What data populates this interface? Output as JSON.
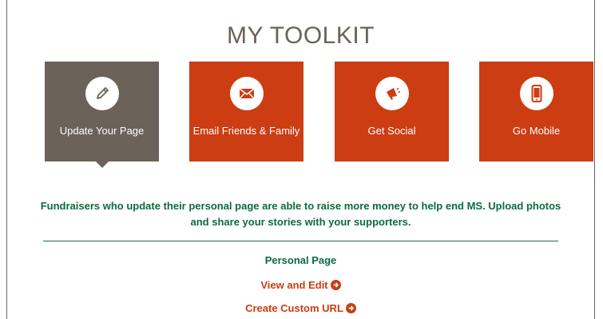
{
  "title": "MY TOOLKIT",
  "tiles": [
    {
      "label": "Update Your Page",
      "icon": "pencil-icon",
      "active": true
    },
    {
      "label": "Email Friends & Family",
      "icon": "envelope-icon",
      "active": false
    },
    {
      "label": "Get Social",
      "icon": "megaphone-icon",
      "active": false
    },
    {
      "label": "Go Mobile",
      "icon": "mobile-phone-icon",
      "active": false
    }
  ],
  "description": "Fundraisers who update their personal page are able to raise more money to help end MS. Upload photos and share your stories with your supporters.",
  "section": {
    "title": "Personal Page",
    "links": [
      {
        "label": "View and Edit"
      },
      {
        "label": "Create Custom URL"
      }
    ]
  },
  "colors": {
    "accent": "#cc3d13",
    "active_tile": "#6b6259",
    "text_green": "#0b6b3e",
    "divider": "#1f6d45"
  }
}
